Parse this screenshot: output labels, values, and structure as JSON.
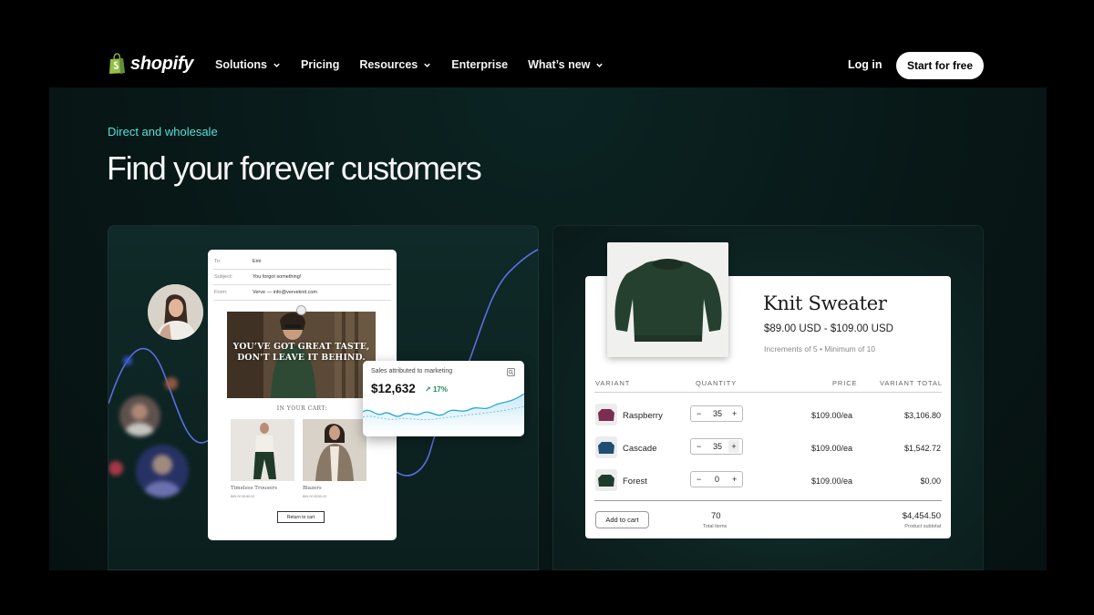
{
  "nav": {
    "logo_text": "shopify",
    "links": [
      {
        "label": "Solutions",
        "has_dropdown": true
      },
      {
        "label": "Pricing",
        "has_dropdown": false
      },
      {
        "label": "Resources",
        "has_dropdown": true
      },
      {
        "label": "Enterprise",
        "has_dropdown": false
      },
      {
        "label": "What’s new",
        "has_dropdown": true
      }
    ],
    "login": "Log in",
    "cta": "Start for free"
  },
  "hero": {
    "eyebrow": "Direct and wholesale",
    "headline": "Find your forever customers"
  },
  "email": {
    "to_label": "To:",
    "to_value": "Emi",
    "subject_label": "Subject:",
    "subject_value": "You forgot something!",
    "from_label": "From:",
    "from_value": "Verve — info@verveknit.com",
    "banner_text": "YOU’VE GOT GREAT TASTE, DON’T LEAVE IT BEHIND.",
    "in_cart": "IN YOUR CART:",
    "products": [
      {
        "name": "Timeless Trousers",
        "price": "$95.00  $180.00"
      },
      {
        "name": "Blazers",
        "price": "$95.00  $200.00"
      }
    ],
    "return_button": "Return to cart"
  },
  "sales": {
    "title": "Sales attributed to marketing",
    "value": "$12,632",
    "delta": "17%"
  },
  "product": {
    "title": "Knit Sweater",
    "price_range": "$89.00 USD - $109.00 USD",
    "increments": "Increments of 5 • Minimum of 10",
    "columns": {
      "variant": "VARIANT",
      "quantity": "QUANTITY",
      "price": "PRICE",
      "total": "VARIANT TOTAL"
    },
    "variants": [
      {
        "name": "Raspberry",
        "qty": "35",
        "price": "$109.00/ea",
        "total": "$3,106.80",
        "color": "#7a2d4f"
      },
      {
        "name": "Cascade",
        "qty": "35",
        "price": "$109.00/ea",
        "total": "$1,542.72",
        "color": "#1d4f74"
      },
      {
        "name": "Forest",
        "qty": "0",
        "price": "$109.00/ea",
        "total": "$0.00",
        "color": "#1f3b2e"
      }
    ],
    "add_to_cart": "Add to cart",
    "total_items": "70",
    "total_items_label": "Total items",
    "subtotal": "$4,454.50",
    "subtotal_label": "Product subtotal",
    "sweater_color": "#25402f"
  },
  "colors": {
    "accent": "#55e0da",
    "chart_line": "#5b6ee1",
    "sales_line": "#2aa7d6",
    "positive": "#1f8a5c"
  }
}
